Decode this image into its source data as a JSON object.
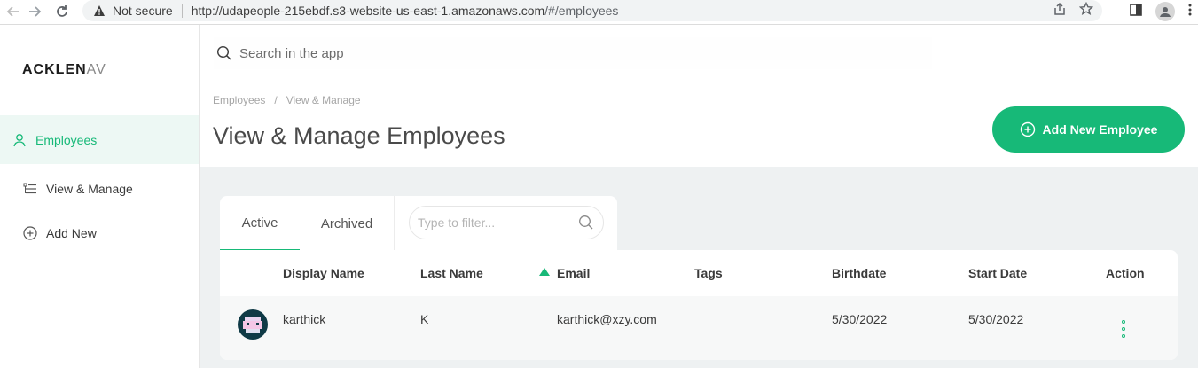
{
  "browser": {
    "security_label": "Not secure",
    "url_main": "http://udapeople-215ebdf.s3-website-us-east-1.amazonaws.com",
    "url_hash": "/#/employees"
  },
  "sidebar": {
    "logo_bold": "ACKLEN",
    "logo_fade": "AV",
    "items": [
      {
        "label": "Employees",
        "icon": "person-icon",
        "active": true
      },
      {
        "label": "View & Manage",
        "icon": "list-icon",
        "active": false
      },
      {
        "label": "Add New",
        "icon": "plus-circle-icon",
        "active": false
      }
    ]
  },
  "header": {
    "search_placeholder": "Search in the app",
    "breadcrumb": [
      "Employees",
      "View & Manage"
    ],
    "breadcrumb_separator": "/",
    "title": "View & Manage Employees",
    "add_button_label": "Add New Employee"
  },
  "tabs": {
    "active_label": "Active",
    "archived_label": "Archived",
    "filter_placeholder": "Type to filter..."
  },
  "table": {
    "columns": [
      "Display Name",
      "Last Name",
      "Email",
      "Tags",
      "Birthdate",
      "Start Date",
      "Action"
    ],
    "sorted_column": "Email",
    "rows": [
      {
        "display_name": "karthick",
        "last_name": "K",
        "email": "karthick@xzy.com",
        "tags": "",
        "birthdate": "5/30/2022",
        "start_date": "5/30/2022"
      }
    ]
  },
  "colors": {
    "accent": "#17b978",
    "content_bg": "#eef1f2"
  }
}
